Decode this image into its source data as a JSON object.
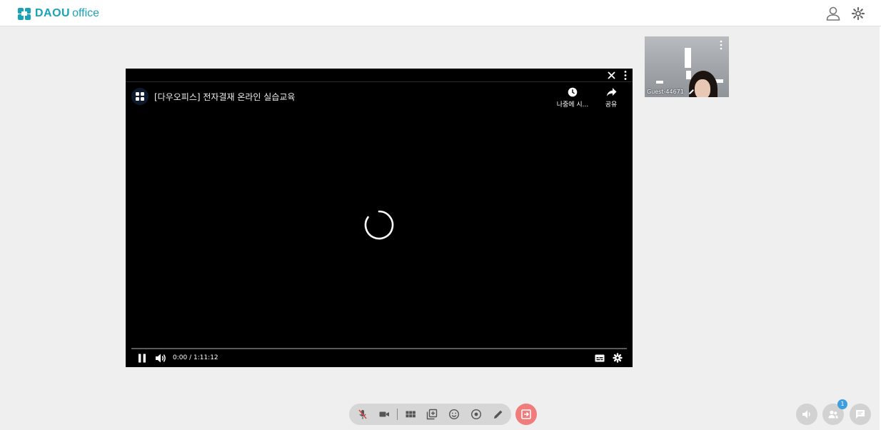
{
  "header": {
    "logo_brand": "DAOU",
    "logo_product": "office",
    "icons": [
      "user-icon",
      "gear-icon"
    ]
  },
  "player": {
    "video_title": "[다우오피스] 전자결재 온라인 실습교육",
    "watch_later_label": "나중에 시...",
    "share_label": "공유",
    "time_display": "0:00 / 1:11:12",
    "state": "loading",
    "icons": [
      "close-icon",
      "more-vert-icon",
      "clock-icon",
      "share-icon",
      "spinner-icon",
      "pause-icon",
      "volume-icon",
      "captions-icon",
      "settings-icon"
    ]
  },
  "participant": {
    "name": "Guest-44671"
  },
  "toolbar": {
    "icons": [
      "mic-off-icon",
      "video-camera-icon",
      "grid-layout-icon",
      "add-screen-icon",
      "emoji-icon",
      "record-icon",
      "pen-icon",
      "leave-icon"
    ]
  },
  "side_controls": {
    "participants_count": "1",
    "icons": [
      "speaker-icon",
      "participants-icon",
      "chat-icon"
    ]
  },
  "colors": {
    "brand": "#1aa3b8",
    "leave": "#f07c7c",
    "badge": "#3d9fe0",
    "background": "#efefef"
  }
}
